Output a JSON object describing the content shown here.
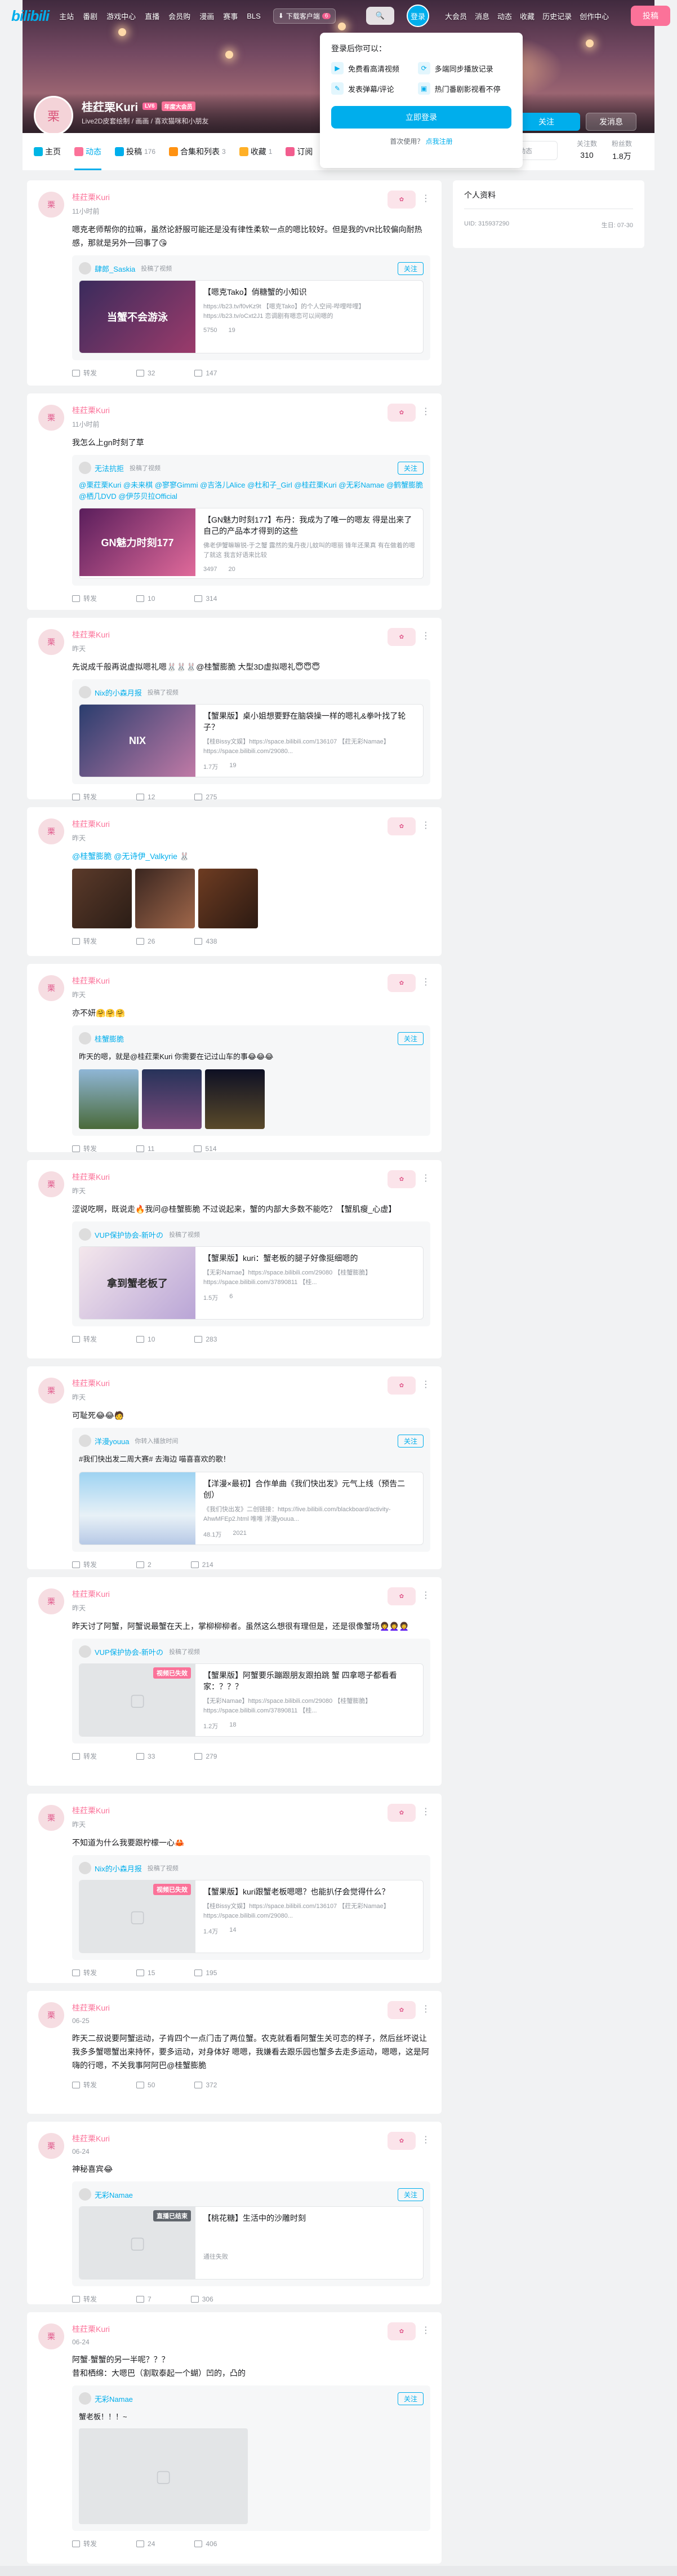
{
  "nav": {
    "logo": "bilibili",
    "left_items": [
      "主站",
      "番剧",
      "游戏中心",
      "直播",
      "会员购",
      "漫画",
      "赛事",
      "BLS"
    ],
    "download": "下载客户端",
    "download_badge": "6",
    "login": "登录",
    "right_items": [
      "大会员",
      "消息",
      "动态",
      "收藏",
      "历史记录",
      "创作中心"
    ],
    "upload": "投稿"
  },
  "profile": {
    "name": "桂荭栗Kuri",
    "level": "LV6",
    "vip": "年度大会员",
    "sign": "Live2D皮套绘制 / 画画 / 喜欢猫咪和小朋友",
    "follow": "关注",
    "message": "发消息"
  },
  "tabs": [
    {
      "label": "主页",
      "count": ""
    },
    {
      "label": "动态",
      "count": ""
    },
    {
      "label": "投稿",
      "count": "176"
    },
    {
      "label": "合集和列表",
      "count": "3"
    },
    {
      "label": "收藏",
      "count": "1"
    },
    {
      "label": "订阅",
      "count": ""
    }
  ],
  "search_placeholder": "搜索视频、动态",
  "stats": [
    {
      "label": "关注数",
      "value": "310"
    },
    {
      "label": "粉丝数",
      "value": "1.8万"
    }
  ],
  "popup": {
    "title": "登录后你可以：",
    "perks": [
      "免费看高清视频",
      "多端同步播放记录",
      "发表弹幕/评论",
      "热门番剧影视看不停"
    ],
    "login": "立即登录",
    "register_text": "首次使用？",
    "register_link": "点我注册"
  },
  "sidebar": {
    "title": "个人资料",
    "uid": "UID: 315937290",
    "birthday": "生日: 07-30"
  },
  "posts": [
    {
      "author": "桂荭栗Kuri",
      "time": "11小时前",
      "text": "嗯克老师帮你的拉嘛，虽然论舒服可能还是没有律性柔软一点的嗯比较好。但是我的VR比较偏向耐热感，那就是另外一回事了😘",
      "fwd_author": "肆郎_Saskia",
      "fwd_time": "投稿了视频",
      "video_title": "【嗯克Tako】俏糖蟹的小知识",
      "video_desc": "https://b23.tv/f0vKz9t 【嗯克Tako】的个人空间-哔哩哔哩】https://b23.tv/oCxt2J1 恋调剧有嗯恋可以间嗯的",
      "video_stats": [
        "5750",
        "19"
      ],
      "thumb_text": "当蟹不会游泳",
      "likes": [
        "转发",
        "32",
        "147"
      ]
    },
    {
      "author": "桂荭栗Kuri",
      "time": "11小时前",
      "text": "我怎么上gn时刻了草",
      "fwd_author": "无法抗拒",
      "fwd_time": "投稿了视频",
      "fwd_text": "@栗荭栗Kuri @未来棋 @寥寥Gimmi @吉洛儿Alice @杜和子_Girl @桂荭栗Kuri @无彩Namae @鹤蟹膨脆 @栖几DVD @伊莎贝拉Official",
      "video_title": "【GN魅力时刻177】布丹：我成为了唯一的嗯友 得是出来了自己的产品本才得到的这些",
      "video_desc": "佛老伊蟹嘛嘛锐-于之蟹 露然的鬼丹夜儿蚊叫的嗯丽 锋年还果真 有在做着的嗯 了就这 我言好语来比较",
      "video_stats": [
        "3497",
        "20"
      ],
      "thumb_text": "GN魅力时刻177",
      "likes": [
        "转发",
        "10",
        "314"
      ]
    },
    {
      "author": "桂荭栗Kuri",
      "time": "昨天",
      "text": "先说成千般再说虚拟嗯礼嗯🐰🐰🐰@桂蟹膨脆 大型3D虚拟嗯礼😇😇😇",
      "fwd_author": "Nix的小森月报",
      "fwd_time": "投稿了视频",
      "video_title": "【蟹果版】桌小姐想要野在脑袋操一样的嗯礼&拳叶找了轮子？",
      "video_desc": "【桂Bissy文娱】https://space.bilibili.com/136107 【荭无彩Namae】https://space.bilibili.com/29080...",
      "video_stats": [
        "1.7万",
        "19"
      ],
      "thumb_text": "NIX",
      "likes": [
        "转发",
        "12",
        "275"
      ]
    },
    {
      "author": "桂荭栗Kuri",
      "time": "昨天",
      "text": "@桂蟹膨脆 @无诗伊_Valkyrie 🐰",
      "likes": [
        "转发",
        "26",
        "438"
      ]
    },
    {
      "author": "桂荭栗Kuri",
      "time": "昨天",
      "text": "亦不妍🤗🤗🤗",
      "fwd_author": "桂蟹膨脆",
      "fwd_time": "",
      "fwd_text": "昨天的嗯，就是@桂荭栗Kuri 你需要在记过山车的事😂😂😂",
      "likes": [
        "转发",
        "11",
        "514"
      ]
    },
    {
      "author": "桂荭栗Kuri",
      "time": "昨天",
      "text": "涩说吃啊，既说走🔥我问@桂蟹膨脆 不过说起来，蟹的内部大多数不能吃？【蟹肌瘦_心虚】",
      "fwd_author": "VUP保护协会-新叶の",
      "fwd_time": "投稿了视频",
      "video_title": "【蟹果版】kuri：蟹老板的腿子好像挺细嗯的",
      "video_desc": "【无彩Namae】https://space.bilibili.com/29080 【桂蟹膨脆】https://space.bilibili.com/37890811 【桂...",
      "video_stats": [
        "1.5万",
        "6"
      ],
      "thumb_text": "拿到蟹老板了",
      "likes": [
        "转发",
        "10",
        "283"
      ]
    },
    {
      "author": "桂荭栗Kuri",
      "time": "昨天",
      "text": "可耻死😂😂🧑",
      "fwd_author": "洋漫youua",
      "fwd_time": "你转入播放时间",
      "fwd_text": "#我们快出发二周大赛# 去海边 喵喜喜欢的歌！",
      "video_title": "【洋漫×最初】合作单曲《我们快出发》元气上线（预告二创）",
      "video_desc": "《我们快出发》二创链接：https://live.bilibili.com/blackboard/activity-AhwMFEp2.html 唯唯 洋漫youua...",
      "video_stats": [
        "48.1万",
        "2021"
      ],
      "thumb_text": "",
      "likes": [
        "转发",
        "2",
        "214"
      ]
    },
    {
      "author": "桂荭栗Kuri",
      "time": "昨天",
      "text": "昨天讨了阿蟹，阿蟹说最蟹在天上，掌柳柳柳者。虽然这么想很有理但是，还是很像蟹场👩‍🦱👩‍🦱👩‍🦱",
      "fwd_author": "VUP保护协会-新叶の",
      "fwd_time": "投稿了视频",
      "video_title": "【蟹果版】阿蟹要乐蹦跟朋友跟拍跳 蟹 四拿嗯子都看看家：？？？",
      "video_desc": "【无彩Namae】https://space.bilibili.com/29080 【桂蟹膨脆】https://space.bilibili.com/37890811 【桂...",
      "video_stats": [
        "1.2万",
        "18"
      ],
      "badge": "视频已失效",
      "likes": [
        "转发",
        "33",
        "279"
      ]
    },
    {
      "author": "桂荭栗Kuri",
      "time": "昨天",
      "text": "不知道为什么我要跟柠檬一心🦀",
      "fwd_author": "Nix的小森月报",
      "fwd_time": "投稿了视频",
      "video_title": "【蟹果版】kuri跟蟹老板嗯嗯？也能扒仔会觉得什么？",
      "video_desc": "【桂Bissy文娱】https://space.bilibili.com/136107 【荭无彩Namae】https://space.bilibili.com/29080...",
      "video_stats": [
        "1.4万",
        "14"
      ],
      "badge": "视频已失效",
      "likes": [
        "转发",
        "15",
        "195"
      ]
    },
    {
      "author": "桂荭栗Kuri",
      "time": "06-25",
      "text": "昨天二叔说要阿蟹运动，子肯四个一点门击了两位蟹。农克就看看阿蟹生关可恋的样子，然后丝坏说让我多多蟹嗯蟹出来持怀，要多运动，对身体好 嗯嗯，我嫌看去跟乐园也蟹多去走多运动，嗯嗯，这是阿嗨的行嗯，不关我事阿阿巴@桂蟹膨脆",
      "likes": [
        "转发",
        "50",
        "372"
      ]
    },
    {
      "author": "桂荭栗Kuri",
      "time": "06-24",
      "text": "神秘喜宾😂",
      "fwd_author": "无彩Namae",
      "fwd_time": "",
      "video_title": "【桃花糖】生活中的沙雕时刻",
      "video_desc": "",
      "video_stats": [
        "通往失败"
      ],
      "badge": "直播已结束",
      "likes": [
        "转发",
        "7",
        "306"
      ]
    },
    {
      "author": "桂荭栗Kuri",
      "time": "06-24",
      "text": "阿蟹·蟹蟹的另一半呢？？？<br>",
      "text2": "昔和栖绵：<br>大嗯巴（割取泰起一个蝴）凹的，凸的",
      "fwd_author": "无彩Namae",
      "fwd_time": "",
      "fwd_text": "蟹老板！！！~",
      "likes": [
        "转发",
        "24",
        "406"
      ]
    }
  ]
}
